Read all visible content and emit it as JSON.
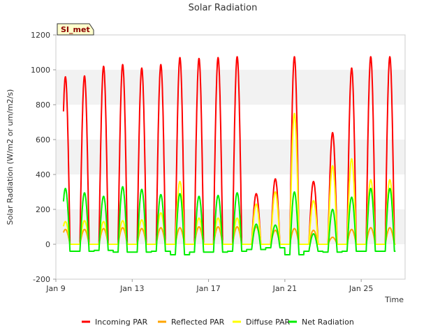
{
  "chart_data": {
    "type": "line",
    "title": "Solar Radiation",
    "station_tag": "SI_met",
    "xlabel": "Time",
    "ylabel": "Solar Radiation (W/m2 or um/m2/s)",
    "ylim": [
      -200,
      1200
    ],
    "yticks": [
      -200,
      0,
      200,
      400,
      600,
      800,
      1000,
      1200
    ],
    "xlim": [
      9.0,
      27.3
    ],
    "xticks": [
      {
        "day": 9,
        "label": "Jan 9"
      },
      {
        "day": 13,
        "label": "Jan 13"
      },
      {
        "day": 17,
        "label": "Jan 17"
      },
      {
        "day": 21,
        "label": "Jan 21"
      },
      {
        "day": 25,
        "label": "Jan 25"
      }
    ],
    "data_start_day": 9.4,
    "data_end_day": 26.8,
    "grid": "horizontal bands",
    "legend_position": "bottom",
    "series": [
      {
        "name": "Incoming PAR",
        "color": "#ff0000"
      },
      {
        "name": "Reflected PAR",
        "color": "#ffa500"
      },
      {
        "name": "Diffuse PAR",
        "color": "#ffff00"
      },
      {
        "name": "Net Radiation",
        "color": "#00ee00"
      }
    ],
    "daily_peaks": [
      {
        "day": 9,
        "incoming": 960,
        "reflected": 85,
        "diffuse": 130,
        "net": 320,
        "night_net": -40
      },
      {
        "day": 10,
        "incoming": 965,
        "reflected": 85,
        "diffuse": 135,
        "net": 295,
        "night_net": -40
      },
      {
        "day": 11,
        "incoming": 1020,
        "reflected": 90,
        "diffuse": 130,
        "net": 275,
        "night_net": -35
      },
      {
        "day": 12,
        "incoming": 1030,
        "reflected": 95,
        "diffuse": 135,
        "net": 330,
        "night_net": -45
      },
      {
        "day": 13,
        "incoming": 1010,
        "reflected": 90,
        "diffuse": 140,
        "net": 315,
        "night_net": -45
      },
      {
        "day": 14,
        "incoming": 1030,
        "reflected": 95,
        "diffuse": 180,
        "net": 285,
        "night_net": -40
      },
      {
        "day": 15,
        "incoming": 1070,
        "reflected": 95,
        "diffuse": 360,
        "net": 290,
        "night_net": -60
      },
      {
        "day": 16,
        "incoming": 1065,
        "reflected": 100,
        "diffuse": 150,
        "net": 275,
        "night_net": -45
      },
      {
        "day": 17,
        "incoming": 1070,
        "reflected": 100,
        "diffuse": 150,
        "net": 280,
        "night_net": -45
      },
      {
        "day": 18,
        "incoming": 1075,
        "reflected": 100,
        "diffuse": 150,
        "net": 295,
        "night_net": -40
      },
      {
        "day": 19,
        "incoming": 290,
        "reflected": 100,
        "diffuse": 230,
        "net": 115,
        "night_net": -30
      },
      {
        "day": 20,
        "incoming": 375,
        "reflected": 80,
        "diffuse": 300,
        "net": 110,
        "night_net": -20
      },
      {
        "day": 21,
        "incoming": 1075,
        "reflected": 90,
        "diffuse": 750,
        "net": 300,
        "night_net": -60
      },
      {
        "day": 22,
        "incoming": 360,
        "reflected": 80,
        "diffuse": 250,
        "net": 60,
        "night_net": -40
      },
      {
        "day": 23,
        "incoming": 640,
        "reflected": 40,
        "diffuse": 450,
        "net": 200,
        "night_net": -45
      },
      {
        "day": 24,
        "incoming": 1010,
        "reflected": 85,
        "diffuse": 490,
        "net": 270,
        "night_net": -40
      },
      {
        "day": 25,
        "incoming": 1075,
        "reflected": 95,
        "diffuse": 370,
        "net": 320,
        "night_net": -40
      }
    ]
  }
}
